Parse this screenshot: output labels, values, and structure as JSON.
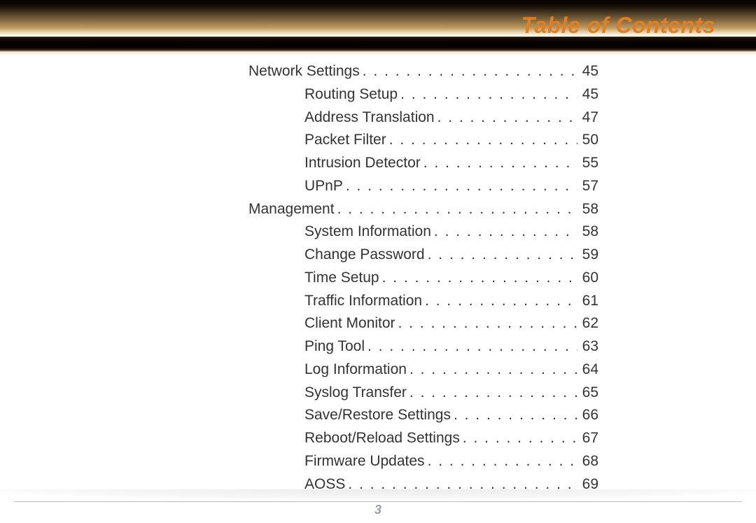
{
  "header": {
    "title": "Table of Contents"
  },
  "toc": {
    "sections": [
      {
        "title": "Network Settings",
        "page": "45",
        "items": [
          {
            "title": "Routing Setup",
            "page": "45"
          },
          {
            "title": "Address Translation",
            "page": "47"
          },
          {
            "title": "Packet Filter",
            "page": "50"
          },
          {
            "title": "Intrusion Detector",
            "page": "55"
          },
          {
            "title": "UPnP",
            "page": "57"
          }
        ]
      },
      {
        "title": "Management",
        "page": "58",
        "items": [
          {
            "title": "System Information",
            "page": "58"
          },
          {
            "title": "Change Password",
            "page": "59"
          },
          {
            "title": "Time Setup",
            "page": "60"
          },
          {
            "title": "Traffic Information",
            "page": "61"
          },
          {
            "title": "Client Monitor",
            "page": "62"
          },
          {
            "title": "Ping Tool",
            "page": "63"
          },
          {
            "title": "Log Information",
            "page": "64"
          },
          {
            "title": "Syslog Transfer",
            "page": "65"
          },
          {
            "title": "Save/Restore Settings",
            "page": "66"
          },
          {
            "title": "Reboot/Reload Settings",
            "page": "67"
          },
          {
            "title": "Firmware Updates",
            "page": "68"
          },
          {
            "title": "AOSS",
            "page": "69"
          }
        ]
      }
    ]
  },
  "footer": {
    "page_number": "3"
  },
  "dots": ". . . . . . . . . . . . . . . . . . . . . . . . . . . . . . . . . . . . . . . . . . . ."
}
